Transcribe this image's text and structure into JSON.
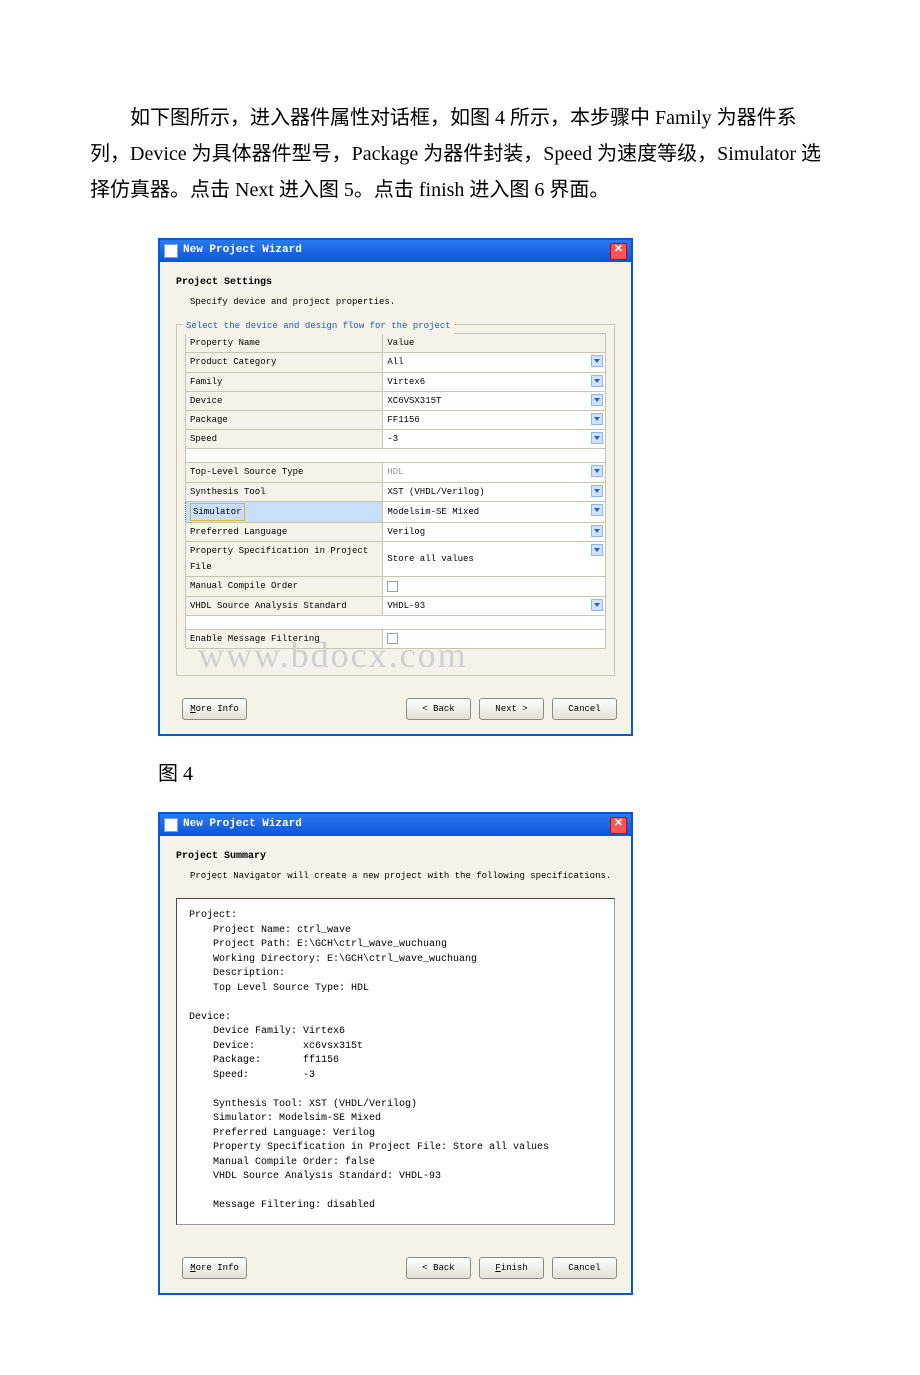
{
  "intro": "　　如下图所示，进入器件属性对话框，如图 4 所示，本步骤中 Family 为器件系列，Device 为具体器件型号，Package 为器件封装，Speed 为速度等级，Simulator 选择仿真器。点击 Next 进入图 5。点击 finish 进入图 6 界面。",
  "caption4": "图 4",
  "watermark": "www.bdocx.com",
  "dlg1": {
    "title": "New Project Wizard",
    "heading": "Project Settings",
    "sub": "Specify device and project properties.",
    "legend": "Select the device and design flow for the project",
    "headers": {
      "prop": "Property Name",
      "val": "Value"
    },
    "rows": {
      "pc": {
        "k": "Product Category",
        "v": "All"
      },
      "fam": {
        "k": "Family",
        "v": "Virtex6"
      },
      "dev": {
        "k": "Device",
        "v": "XC6VSX315T"
      },
      "pkg": {
        "k": "Package",
        "v": "FF1156"
      },
      "spd": {
        "k": "Speed",
        "v": "-3"
      },
      "tls": {
        "k": "Top-Level Source Type",
        "v": "HDL"
      },
      "syn": {
        "k": "Synthesis Tool",
        "v": "XST (VHDL/Verilog)"
      },
      "sim": {
        "k": "Simulator",
        "v": "Modelsim-SE Mixed"
      },
      "pl": {
        "k": "Preferred Language",
        "v": "Verilog"
      },
      "psf": {
        "k": "Property Specification in Project File",
        "v": "Store all values"
      },
      "mco": {
        "k": "Manual Compile Order"
      },
      "vsa": {
        "k": "VHDL Source Analysis Standard",
        "v": "VHDL-93"
      },
      "emf": {
        "k": "Enable Message Filtering"
      }
    },
    "buttons": {
      "more": "More Info",
      "back": "< Back",
      "next": "Next >",
      "cancel": "Cancel"
    }
  },
  "dlg2": {
    "title": "New Project Wizard",
    "heading": "Project Summary",
    "sub": "Project Navigator will create a new project with the following specifications.",
    "summary": "Project:\n    Project Name: ctrl_wave\n    Project Path: E:\\GCH\\ctrl_wave_wuchuang\n    Working Directory: E:\\GCH\\ctrl_wave_wuchuang\n    Description:\n    Top Level Source Type: HDL\n\nDevice:\n    Device Family: Virtex6\n    Device:        xc6vsx315t\n    Package:       ff1156\n    Speed:         -3\n\n    Synthesis Tool: XST (VHDL/Verilog)\n    Simulator: Modelsim-SE Mixed\n    Preferred Language: Verilog\n    Property Specification in Project File: Store all values\n    Manual Compile Order: false\n    VHDL Source Analysis Standard: VHDL-93\n\n    Message Filtering: disabled",
    "buttons": {
      "more": "More Info",
      "back": "< Back",
      "finish": "Finish",
      "cancel": "Cancel"
    }
  }
}
